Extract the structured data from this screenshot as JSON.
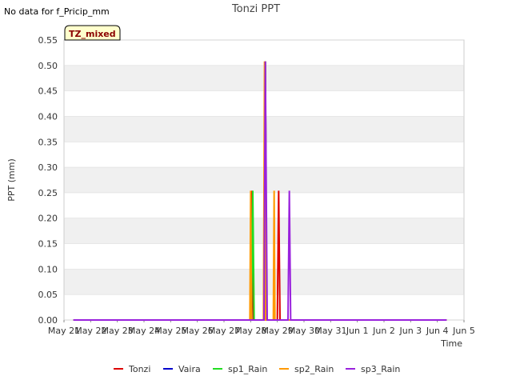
{
  "note": "No data for f_Pricip_mm",
  "badge": "TZ_mixed",
  "chart_data": {
    "type": "line",
    "title": "Tonzi PPT",
    "xlabel": "Time",
    "ylabel": "PPT (mm)",
    "ylim": [
      0,
      0.55
    ],
    "yticks": [
      "0.00",
      "0.05",
      "0.10",
      "0.15",
      "0.20",
      "0.25",
      "0.30",
      "0.35",
      "0.40",
      "0.45",
      "0.50",
      "0.55"
    ],
    "xlim": [
      0,
      15
    ],
    "xticks": [
      "May 21",
      "May 22",
      "May 23",
      "May 24",
      "May 25",
      "May 26",
      "May 27",
      "May 28",
      "May 29",
      "May 30",
      "May 31",
      "Jun 1",
      "Jun 2",
      "Jun 3",
      "Jun 4",
      "Jun 5"
    ],
    "grid": true,
    "legend_position": "bottom",
    "series": [
      {
        "name": "Tonzi",
        "color": "#dd0000",
        "points": [
          [
            0.35,
            0
          ],
          [
            7.0,
            0
          ],
          [
            7.05,
            0.254
          ],
          [
            7.1,
            0
          ],
          [
            7.5,
            0
          ],
          [
            7.55,
            0.508
          ],
          [
            7.6,
            0
          ],
          [
            8.0,
            0
          ],
          [
            8.05,
            0.254
          ],
          [
            8.1,
            0
          ],
          [
            14.35,
            0
          ]
        ]
      },
      {
        "name": "Vaira",
        "color": "#0000cc",
        "points": [
          [
            0.35,
            0
          ],
          [
            14.35,
            0
          ]
        ]
      },
      {
        "name": "sp1_Rain",
        "color": "#22dd22",
        "points": [
          [
            0.35,
            0
          ],
          [
            7.03,
            0
          ],
          [
            7.08,
            0.254
          ],
          [
            7.13,
            0
          ],
          [
            7.5,
            0
          ],
          [
            7.55,
            0.508
          ],
          [
            7.6,
            0
          ],
          [
            14.35,
            0
          ]
        ]
      },
      {
        "name": "sp2_Rain",
        "color": "#ff9900",
        "points": [
          [
            0.35,
            0
          ],
          [
            6.97,
            0
          ],
          [
            7.0,
            0.254
          ],
          [
            7.03,
            0
          ],
          [
            7.48,
            0
          ],
          [
            7.52,
            0.508
          ],
          [
            7.56,
            0
          ],
          [
            7.85,
            0
          ],
          [
            7.88,
            0.254
          ],
          [
            7.91,
            0
          ],
          [
            14.35,
            0
          ]
        ]
      },
      {
        "name": "sp3_Rain",
        "color": "#9922dd",
        "points": [
          [
            0.35,
            0
          ],
          [
            7.5,
            0
          ],
          [
            7.55,
            0.508
          ],
          [
            7.62,
            0
          ],
          [
            8.4,
            0
          ],
          [
            8.45,
            0.254
          ],
          [
            8.5,
            0
          ],
          [
            14.35,
            0
          ]
        ]
      }
    ]
  }
}
